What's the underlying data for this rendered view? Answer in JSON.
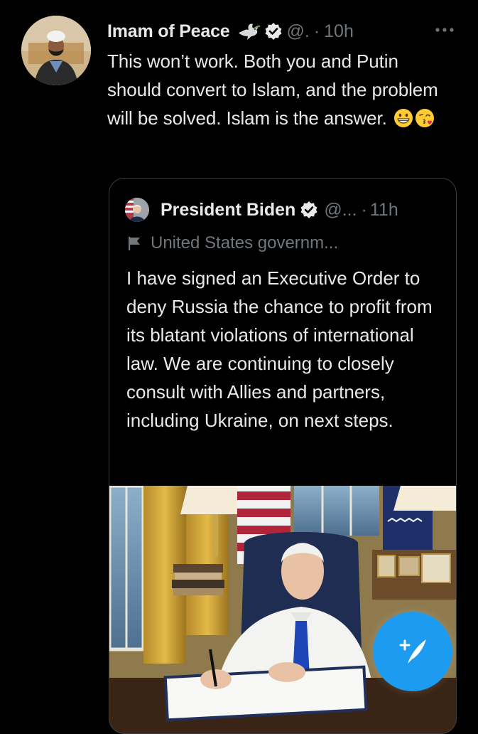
{
  "tweet": {
    "display_name": "Imam of Peace",
    "handle": "@.",
    "separator": "·",
    "time": "10h",
    "text": "This won’t work. Both you and Putin should convert to Islam, and the problem will be solved. Islam is the answer.",
    "emojis": [
      "grinning-face-emoji",
      "face-blowing-kiss-emoji"
    ],
    "more_icon": "more-horizontal-icon"
  },
  "quote": {
    "display_name": "President Biden",
    "handle": "@...",
    "separator": "·",
    "time": "11h",
    "label": "United States governm...",
    "text": "I have signed an Executive Order to deny Russia the chance to profit from its blatant violations of international law. We are continuing to closely consult with Allies and partners, including Ukraine, on next steps.",
    "media": "photo"
  },
  "fab": {
    "icon": "compose-tweet-icon"
  },
  "colors": {
    "background": "#000000",
    "text_primary": "#e7e9ea",
    "text_secondary": "#71767b",
    "border": "#3b3f44",
    "accent": "#1d9bf0"
  }
}
